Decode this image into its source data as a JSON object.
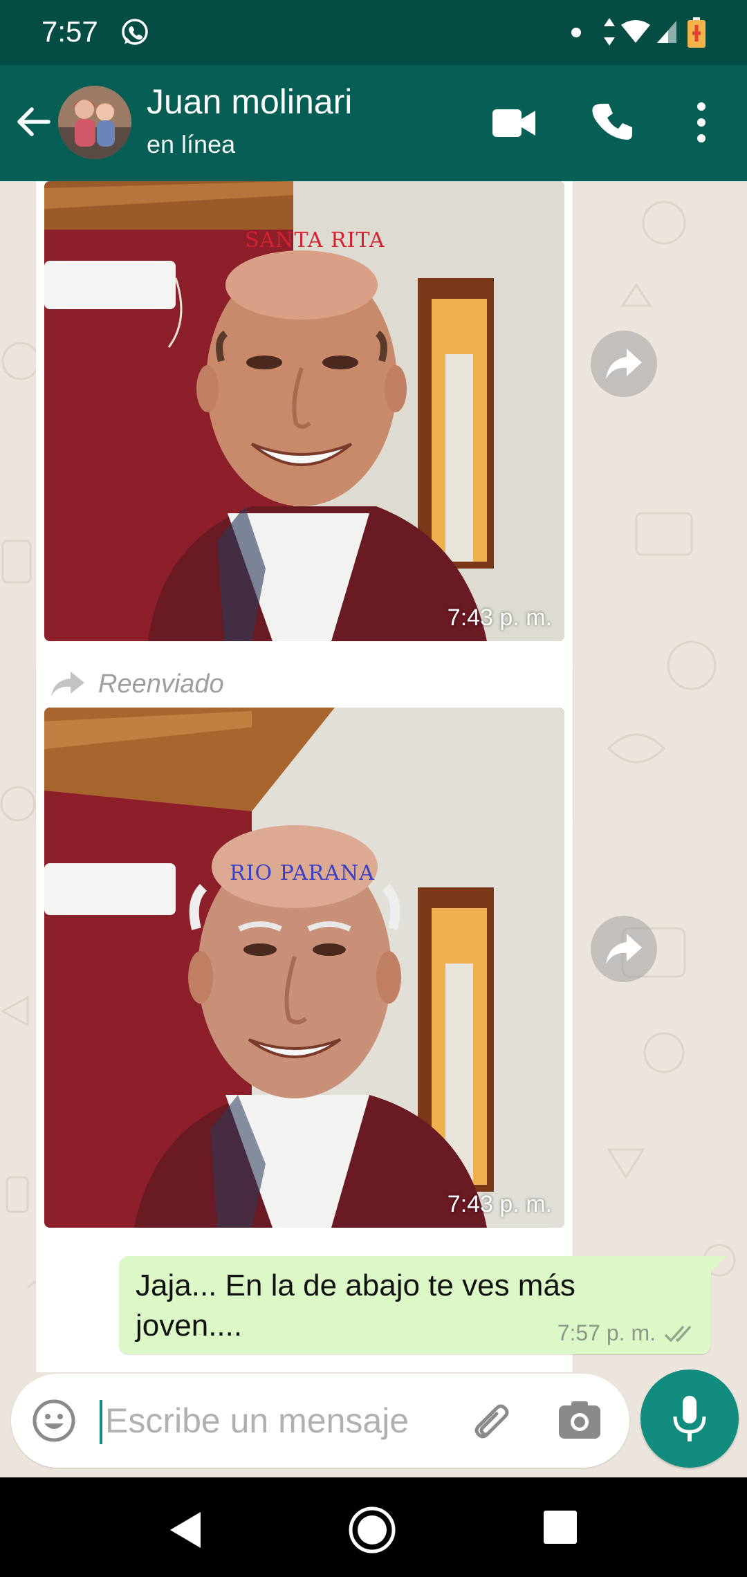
{
  "status_bar": {
    "time": "7:57",
    "icons": [
      "whatsapp-icon",
      "dot-icon",
      "data-arrows-icon",
      "wifi-icon",
      "signal-icon",
      "battery-charging-icon"
    ]
  },
  "header": {
    "contact_name": "Juan molinari",
    "contact_status": "en línea",
    "icons": [
      "back-arrow-icon",
      "video-call-icon",
      "phone-icon",
      "more-vert-icon"
    ]
  },
  "messages": [
    {
      "type": "image",
      "direction": "incoming",
      "caption": "SANTA RITA",
      "caption_color": "#d6202f",
      "time": "7:43 p. m."
    },
    {
      "type": "image",
      "direction": "incoming",
      "forwarded_label": "Reenviado",
      "caption": "RIO PARANA",
      "caption_color": "#3b3fc4",
      "time": "7:43 p. m."
    },
    {
      "type": "text",
      "direction": "outgoing",
      "text": "Jaja... En la de abajo te ves más joven....",
      "time": "7:57 p. m.",
      "status": "double-check-icon"
    }
  ],
  "composer": {
    "placeholder": "Escribe un mensaje",
    "value": ""
  },
  "colors": {
    "header": "#075e54",
    "status_bar": "#054d44",
    "accent": "#128c7e",
    "outgoing_bubble": "#dcf8c6",
    "chat_bg": "#ece5dd"
  }
}
